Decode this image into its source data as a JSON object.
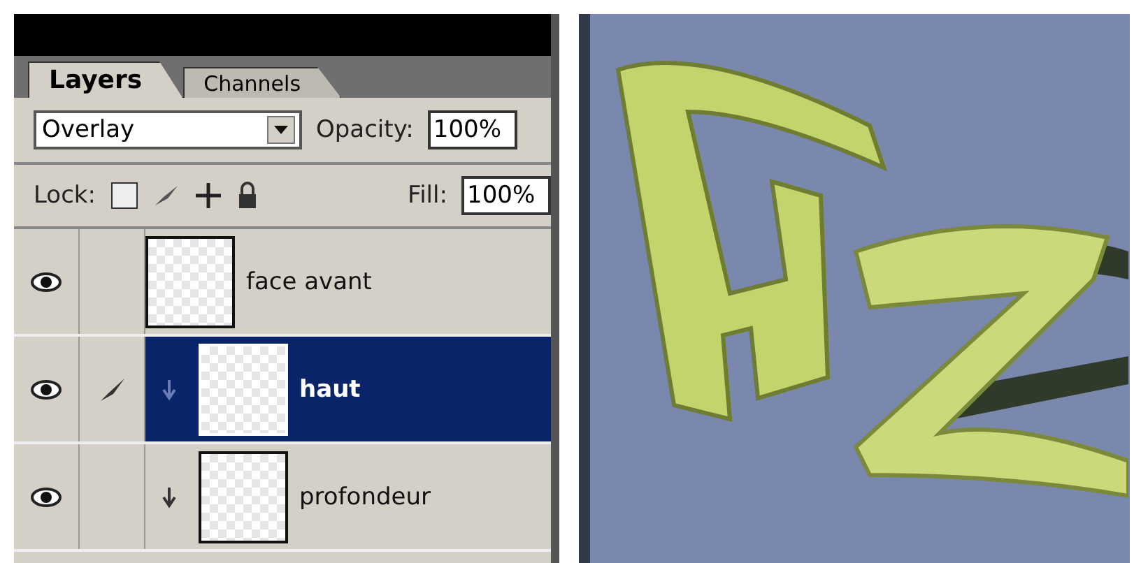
{
  "tabs": [
    {
      "label": "Layers",
      "selected": true
    },
    {
      "label": "Channels",
      "selected": false
    }
  ],
  "blend_mode": {
    "value": "Overlay"
  },
  "opacity": {
    "label": "Opacity:",
    "value": "100%"
  },
  "lock": {
    "label": "Lock:"
  },
  "fill": {
    "label": "Fill:",
    "value": "100%"
  },
  "layers": [
    {
      "name": "face avant",
      "selected": false,
      "visible": true,
      "clipped": false
    },
    {
      "name": "haut",
      "selected": true,
      "visible": true,
      "clipped": true
    },
    {
      "name": "profondeur",
      "selected": false,
      "visible": true,
      "clipped": true
    }
  ]
}
